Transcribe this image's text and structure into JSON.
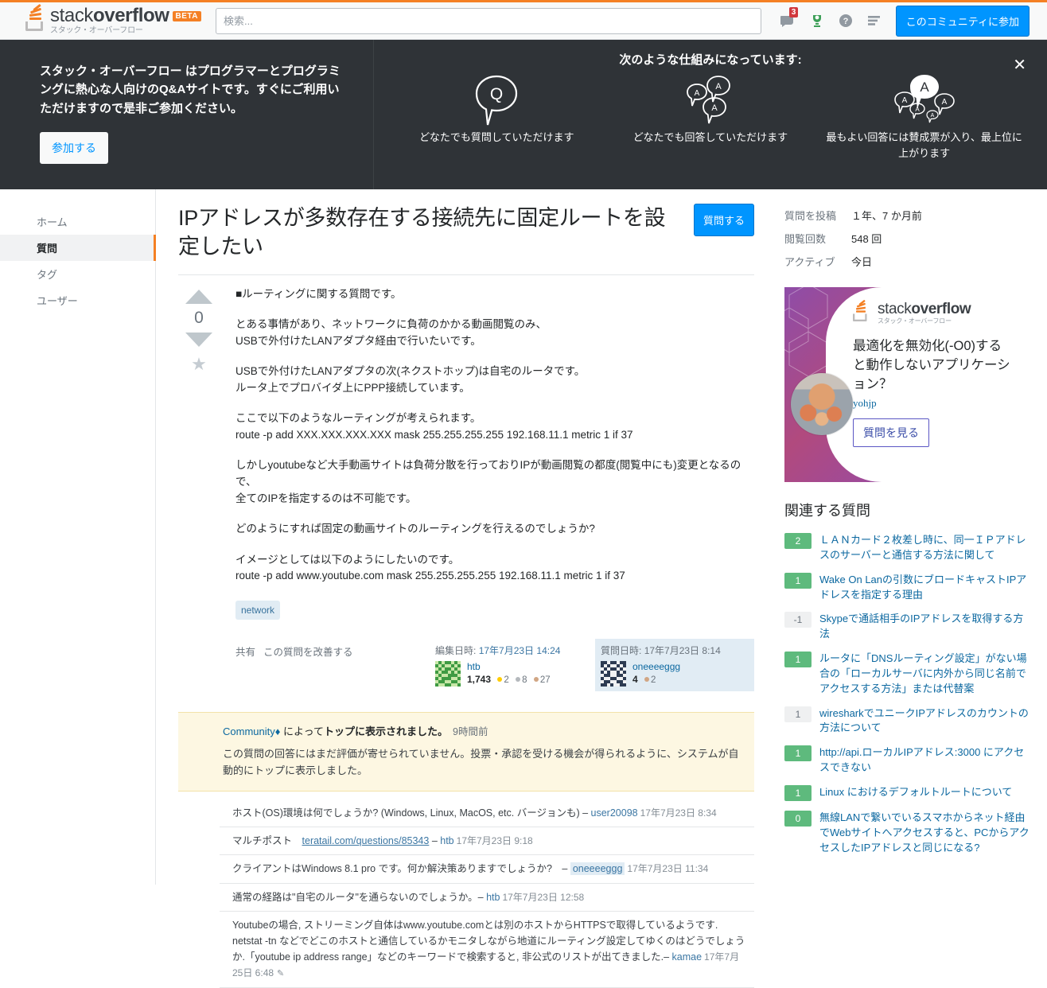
{
  "header": {
    "logo_stack": "stack",
    "logo_overflow": "overflow",
    "logo_beta": "BETA",
    "logo_sub": "スタック・オーバーフロー",
    "search_placeholder": "検索...",
    "search_value": "",
    "inbox_badge": "3",
    "join_button": "このコミュニティに参加",
    "icons": [
      "inbox-icon",
      "trophy-icon",
      "help-icon",
      "list-icon"
    ]
  },
  "hero": {
    "intro": "スタック・オーバーフロー はプログラマーとプログラミングに熱心な人向けのQ&Aサイトです。すぐにご利用いただけますので是非ご参加ください。",
    "join_button": "参加する",
    "title": "次のような仕組みになっています:",
    "close_label": "✕",
    "cards": [
      {
        "icon": "question-bubble-icon",
        "caption": "どなたでも質問していただけます"
      },
      {
        "icon": "answers-bubbles-icon",
        "caption": "どなたでも回答していただけます"
      },
      {
        "icon": "top-answer-bubbles-icon",
        "caption": "最もよい回答には賛成票が入り、最上位に上がります"
      }
    ]
  },
  "sidebar": {
    "items": [
      {
        "label": "ホーム",
        "active": false
      },
      {
        "label": "質問",
        "active": true
      },
      {
        "label": "タグ",
        "active": false
      },
      {
        "label": "ユーザー",
        "active": false
      }
    ]
  },
  "question": {
    "title": "IPアドレスが多数存在する接続先に固定ルートを設定したい",
    "ask_button": "質問する",
    "vote_count": "0",
    "paragraphs": [
      "■ルーティングに関する質問です。",
      "とある事情があり、ネットワークに負荷のかかる動画閲覧のみ、\nUSBで外付けたLANアダプタ経由で行いたいです。",
      "USBで外付けたLANアダプタの次(ネクストホップ)は自宅のルータです。\nルータ上でプロバイダ上にPPP接続しています。",
      "ここで以下のようなルーティングが考えられます。\nroute -p add XXX.XXX.XXX.XXX mask 255.255.255.255 192.168.11.1 metric 1 if 37",
      "しかしyoutubeなど大手動画サイトは負荷分散を行っておりIPが動画閲覧の都度(閲覧中にも)変更となるので、\n全てのIPを指定するのは不可能です。",
      "どのようにすれば固定の動画サイトのルーティングを行えるのでしょうか?",
      "イメージとしては以下のようにしたいのです。\nroute -p add www.youtube.com mask 255.255.255.255 192.168.11.1 metric 1 if 37"
    ],
    "tags": [
      "network"
    ],
    "share_label": "共有",
    "improve_label": "この質問を改善する",
    "editor_card": {
      "time_label": "編集日時:",
      "time_value": "17年7月23日 14:24",
      "user": "htb",
      "rep": "1,743",
      "gold": "2",
      "silver": "8",
      "bronze": "27"
    },
    "owner_card": {
      "time_label": "質問日時:",
      "time_value": "17年7月23日 8:14",
      "user": "oneeeeggg",
      "rep": "4",
      "bronze": "2"
    }
  },
  "notice": {
    "user": "Community",
    "diamond": "♦",
    "by": "によって",
    "bold_part": "トップに表示されました。",
    "age": "9時間前",
    "body": "この質問の回答にはまだ評価が寄せられていません。投票・承認を受ける機会が得られるように、システムが自動的にトップに表示しました。"
  },
  "comments": [
    {
      "text": "ホスト(OS)環境は何でしょうか? (Windows, Linux, MacOS, etc. バージョンも) – ",
      "user": "user20098",
      "owner": false,
      "time": "17年7月23日 8:34",
      "link": "",
      "edited": false
    },
    {
      "text": "マルチポスト　",
      "user": "htb",
      "owner": false,
      "time": "17年7月23日 9:18",
      "link": "teratail.com/questions/85343",
      "edited": false
    },
    {
      "text": "クライアントはWindows 8.1 pro です。何か解決策ありますでしょうか?　– ",
      "user": "oneeeeggg",
      "owner": true,
      "time": "17年7月23日 11:34",
      "link": "",
      "edited": false
    },
    {
      "text": "通常の経路は\"自宅のルータ\"を通らないのでしょうか。– ",
      "user": "htb",
      "owner": false,
      "time": "17年7月23日 12:58",
      "link": "",
      "edited": false
    },
    {
      "text": "Youtubeの場合, ストリーミング自体はwww.youtube.comとは別のホストからHTTPSで取得しているようです. netstat -tn などでどこのホストと通信しているかモニタしながら地道にルーティング設定してゆくのはどうでしょうか.「youtube ip address range」などのキーワードで検索すると, 非公式のリストが出てきました.– ",
      "user": "kamae",
      "owner": false,
      "time": "17年7月25日 6:48",
      "link": "",
      "edited": true
    }
  ],
  "rail": {
    "stats": [
      {
        "key": "質問を投稿",
        "value": "１年、7 か月前"
      },
      {
        "key": "閲覧回数",
        "value": "548 回"
      },
      {
        "key": "アクティブ",
        "value": "今日"
      }
    ],
    "ad": {
      "logo_stack": "stack",
      "logo_overflow": "overflow",
      "logo_sub": "スタック・オーバーフロー",
      "title": "最適化を無効化(-O0)すると動作しないアプリケーション？",
      "user": "yohjp",
      "button": "質問を見る"
    },
    "related_title": "関連する質問",
    "related": [
      {
        "score": "2",
        "negative": false,
        "title": "ＬＡＮカード２枚差し時に、同一ＩＰアドレスのサーバーと通信する方法に関して"
      },
      {
        "score": "1",
        "negative": false,
        "title": "Wake On Lanの引数にブロードキャストIPアドレスを指定する理由"
      },
      {
        "score": "-1",
        "negative": true,
        "title": "Skypeで通話相手のIPアドレスを取得する方法"
      },
      {
        "score": "1",
        "negative": false,
        "title": "ルータに「DNSルーティング設定」がない場合の「ローカルサーバに内外から同じ名前でアクセスする方法」または代替案"
      },
      {
        "score": "1",
        "negative": true,
        "title": "wiresharkでユニークIPアドレスのカウントの方法について"
      },
      {
        "score": "1",
        "negative": false,
        "title": "http://api.ローカルIPアドレス:3000 にアクセスできない"
      },
      {
        "score": "1",
        "negative": false,
        "title": "Linux におけるデフォルトルートについて"
      },
      {
        "score": "0",
        "negative": false,
        "title": "無線LANで繋いでいるスマホからネット経由でWebサイトへアクセスすると、PCからアクセスしたIPアドレスと同じになる?"
      }
    ]
  },
  "colors": {
    "accent_orange": "#f48024",
    "link_blue": "#0c68a0",
    "button_blue": "#0095ff",
    "hero_bg": "#2f3337",
    "score_green": "#5eba7d",
    "tag_bg": "#e1ecf4",
    "notice_bg": "#fdf7e2"
  }
}
